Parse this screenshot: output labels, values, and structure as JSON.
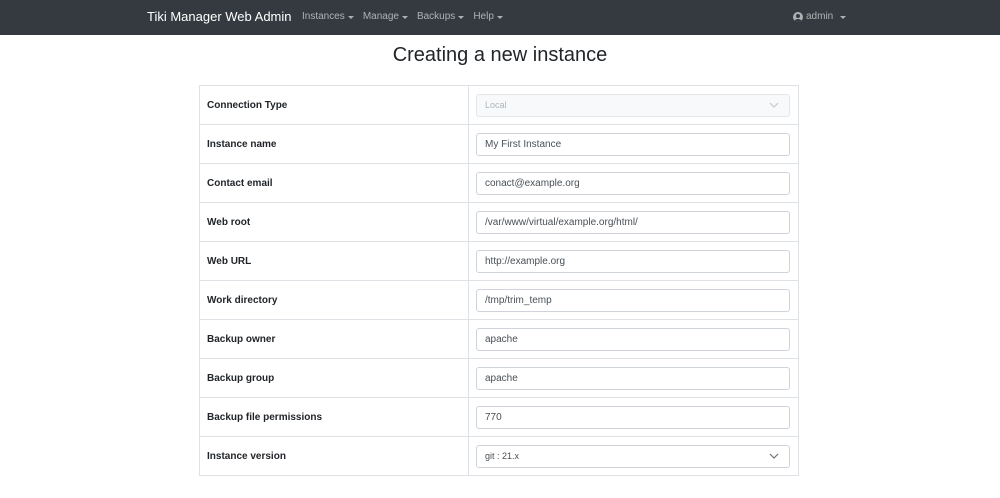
{
  "navbar": {
    "brand": "Tiki Manager Web Admin",
    "menu": [
      {
        "label": "Instances"
      },
      {
        "label": "Manage"
      },
      {
        "label": "Backups"
      },
      {
        "label": "Help"
      }
    ],
    "user": {
      "label": "admin",
      "icon": "user-circle-icon"
    }
  },
  "page": {
    "title": "Creating a new instance"
  },
  "form": {
    "connection_type": {
      "label": "Connection Type",
      "value": "Local"
    },
    "instance_name": {
      "label": "Instance name",
      "value": "My First Instance"
    },
    "contact_email": {
      "label": "Contact email",
      "value": "conact@example.org"
    },
    "web_root": {
      "label": "Web root",
      "value": "/var/www/virtual/example.org/html/"
    },
    "web_url": {
      "label": "Web URL",
      "value": "http://example.org"
    },
    "work_directory": {
      "label": "Work directory",
      "value": "/tmp/trim_temp"
    },
    "backup_owner": {
      "label": "Backup owner",
      "value": "apache"
    },
    "backup_group": {
      "label": "Backup group",
      "value": "apache"
    },
    "backup_file_permissions": {
      "label": "Backup file permissions",
      "value": "770"
    },
    "instance_version": {
      "label": "Instance version",
      "value": "git : 21.x"
    }
  },
  "colors": {
    "navbar_bg": "#343a40",
    "border": "#dee2e6"
  }
}
